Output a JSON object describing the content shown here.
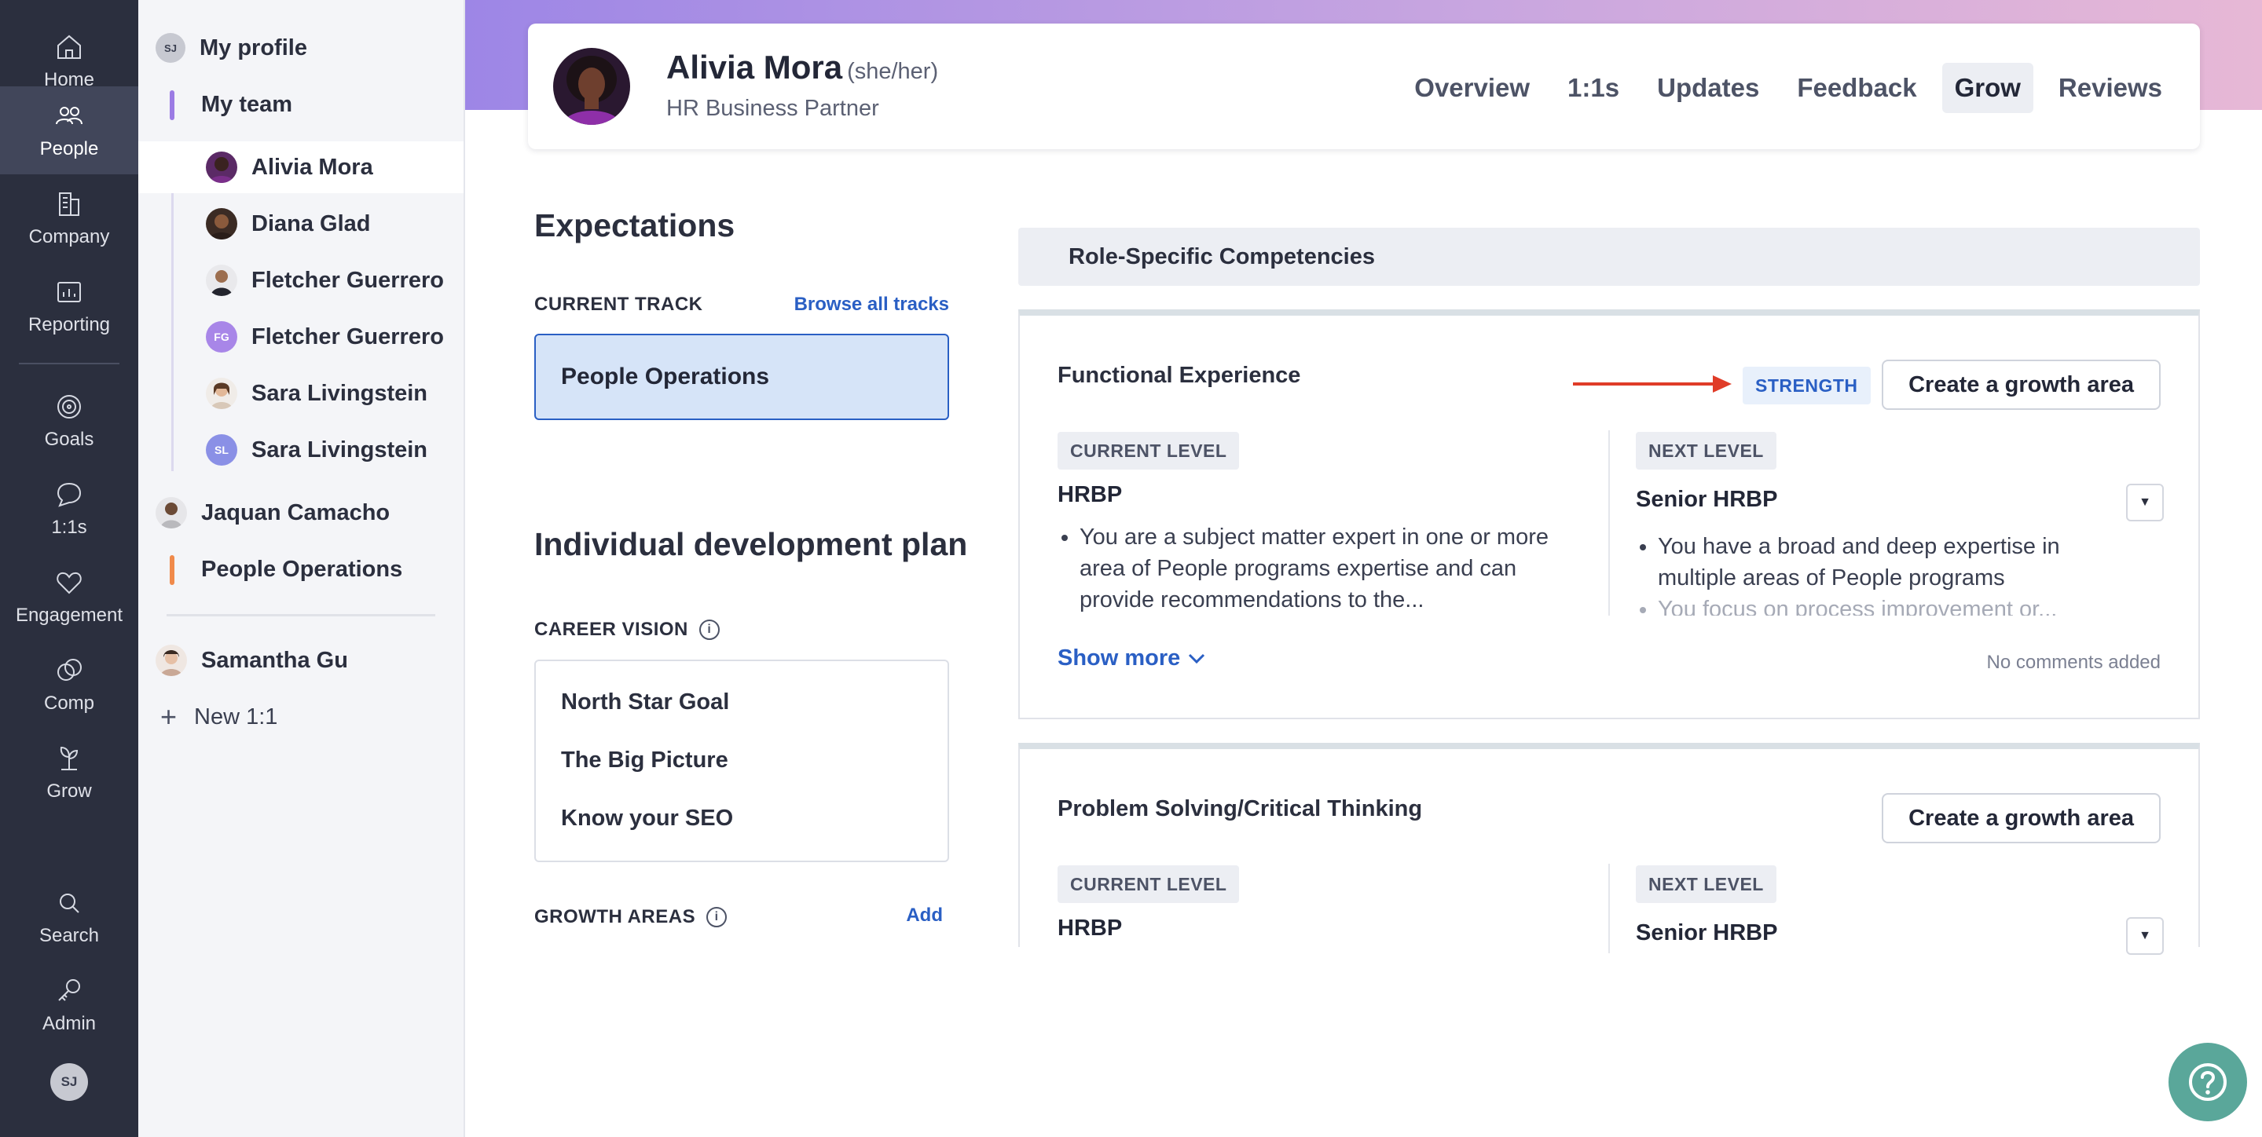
{
  "rail": {
    "items": [
      {
        "label": "Home",
        "icon": "home-icon"
      },
      {
        "label": "People",
        "icon": "people-icon"
      },
      {
        "label": "Company",
        "icon": "company-icon"
      },
      {
        "label": "Reporting",
        "icon": "reporting-icon"
      },
      {
        "label": "Goals",
        "icon": "goals-icon"
      },
      {
        "label": "1:1s",
        "icon": "chat-icon"
      },
      {
        "label": "Engagement",
        "icon": "heart-icon"
      },
      {
        "label": "Comp",
        "icon": "comp-icon"
      },
      {
        "label": "Grow",
        "icon": "grow-icon"
      },
      {
        "label": "Search",
        "icon": "search-icon"
      },
      {
        "label": "Admin",
        "icon": "key-icon"
      }
    ],
    "active": "People",
    "avatar_initials": "SJ"
  },
  "sidebar": {
    "my_profile": {
      "label": "My profile",
      "initials": "SJ"
    },
    "my_team": "My team",
    "team": [
      {
        "name": "Alivia Mora"
      },
      {
        "name": "Diana Glad"
      },
      {
        "name": "Fletcher Guerrero"
      },
      {
        "name": "Fletcher Guerrero",
        "initials": "FG"
      },
      {
        "name": "Sara Livingstein"
      },
      {
        "name": "Sara Livingstein",
        "initials": "SL"
      }
    ],
    "jaquan": "Jaquan Camacho",
    "people_ops": "People Operations",
    "samantha": "Samantha Gu",
    "new_11": "New 1:1"
  },
  "header": {
    "name": "Alivia Mora",
    "pronouns": "(she/her)",
    "role": "HR Business Partner",
    "tabs": [
      "Overview",
      "1:1s",
      "Updates",
      "Feedback",
      "Grow",
      "Reviews"
    ],
    "active_tab": "Grow"
  },
  "expectations": {
    "title": "Expectations",
    "current_track_label": "CURRENT TRACK",
    "browse_link": "Browse all tracks",
    "track": "People Operations"
  },
  "idp": {
    "title": "Individual development plan",
    "career_vision_label": "CAREER VISION",
    "vision_items": [
      "North Star Goal",
      "The Big Picture",
      "Know your SEO"
    ],
    "growth_areas_label": "GROWTH AREAS",
    "add_link": "Add"
  },
  "competencies": {
    "header": "Role-Specific Competencies",
    "cards": [
      {
        "title": "Functional Experience",
        "badge": "STRENGTH",
        "button": "Create a growth area",
        "current_label": "CURRENT LEVEL",
        "current_level": "HRBP",
        "current_bullets": [
          "You are a subject matter expert in one or more area of People programs expertise and can provide recommendations to the..."
        ],
        "next_label": "NEXT LEVEL",
        "next_level": "Senior HRBP",
        "next_bullets": [
          "You have a broad and deep expertise in multiple areas of People programs",
          "You focus on process improvement or..."
        ],
        "show_more": "Show more",
        "comments": "No comments added"
      },
      {
        "title": "Problem Solving/Critical Thinking",
        "button": "Create a growth area",
        "current_label": "CURRENT LEVEL",
        "current_level": "HRBP",
        "next_label": "NEXT LEVEL",
        "next_level": "Senior HRBP"
      }
    ]
  },
  "colors": {
    "rail_bg": "#2b2f3e",
    "accent_blue": "#2a5fc4",
    "arrow_red": "#e03c28",
    "help_green": "#5aa79a"
  }
}
